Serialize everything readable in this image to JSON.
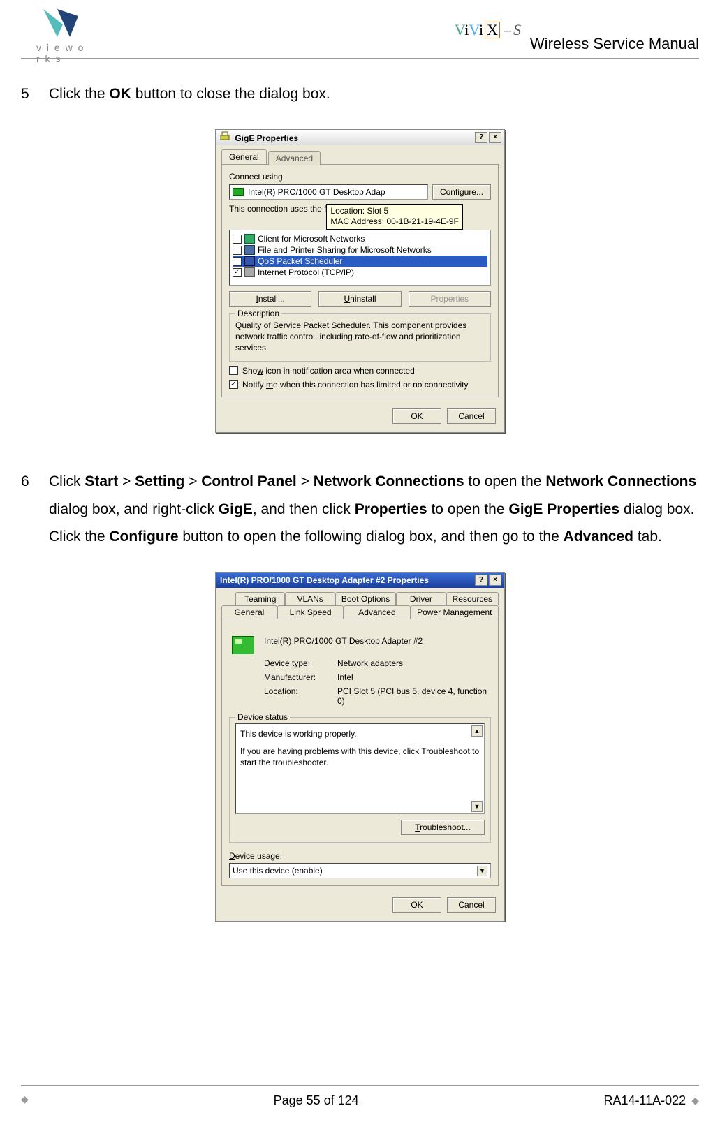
{
  "header": {
    "brand_text": "v i e w o r k s",
    "product": "ViViX-S",
    "doc_title": "Wireless Service Manual"
  },
  "steps": {
    "s5": {
      "num": "5",
      "text_pre": "Click the ",
      "bold1": "OK",
      "text_post": " button to close the dialog box."
    },
    "s6": {
      "num": "6",
      "p1": "Click ",
      "b1": "Start",
      "sep1": " > ",
      "b2": "Setting",
      "sep2": " > ",
      "b3": "Control Panel",
      "sep3": " > ",
      "b4": "Network Connections",
      "p2": " to open the ",
      "b5": "Network Connections",
      "p3": " dialog box, and right-click ",
      "b6": "GigE",
      "p4": ", and then click ",
      "b7": "Properties",
      "p5": " to open the ",
      "b8": "GigE Properties",
      "p6": " dialog box. Click the ",
      "b9": "Configure",
      "p7": " button to open the following dialog box, and then go to the ",
      "b10": "Advanced",
      "p8": " tab."
    }
  },
  "dlg1": {
    "title": "GigE Properties",
    "tab_general": "General",
    "tab_advanced": "Advanced",
    "connect_using": "Connect using:",
    "adapter": "Intel(R) PRO/1000 GT Desktop Adap",
    "configure": "Configure...",
    "tooltip_line1": "Location: Slot 5",
    "tooltip_line2": "MAC Address: 00-1B-21-19-4E-9F",
    "uses_label": "This connection uses the f",
    "item1": "Client for Microsoft Networks",
    "item2": "File and Printer Sharing for Microsoft Networks",
    "item3": "QoS Packet Scheduler",
    "item4": "Internet Protocol (TCP/IP)",
    "install": "Install...",
    "uninstall": "Uninstall",
    "properties": "Properties",
    "desc_title": "Description",
    "desc_text": "Quality of Service Packet Scheduler. This component provides network traffic control, including rate-of-flow and prioritization services.",
    "show_icon": "Show icon in notification area when connected",
    "notify_me": "Notify me when this connection has limited or no connectivity",
    "ok": "OK",
    "cancel": "Cancel"
  },
  "dlg2": {
    "title": "Intel(R) PRO/1000 GT Desktop Adapter #2 Properties",
    "tabs_row1": [
      "Teaming",
      "VLANs",
      "Boot Options",
      "Driver",
      "Resources"
    ],
    "tabs_row2": [
      "General",
      "Link Speed",
      "Advanced",
      "Power Management"
    ],
    "name": "Intel(R) PRO/1000 GT Desktop Adapter #2",
    "devtype_lbl": "Device type:",
    "devtype_val": "Network adapters",
    "manu_lbl": "Manufacturer:",
    "manu_val": "Intel",
    "loc_lbl": "Location:",
    "loc_val": "PCI Slot 5 (PCI bus 5, device 4, function 0)",
    "status_title": "Device status",
    "status_l1": "This device is working properly.",
    "status_l2": "If you are having problems with this device, click Troubleshoot to start the troubleshooter.",
    "troubleshoot": "Troubleshoot...",
    "usage_lbl": "Device usage:",
    "usage_val": "Use this device (enable)",
    "ok": "OK",
    "cancel": "Cancel"
  },
  "footer": {
    "page": "Page 55 of 124",
    "doc_num": "RA14-11A-022"
  }
}
